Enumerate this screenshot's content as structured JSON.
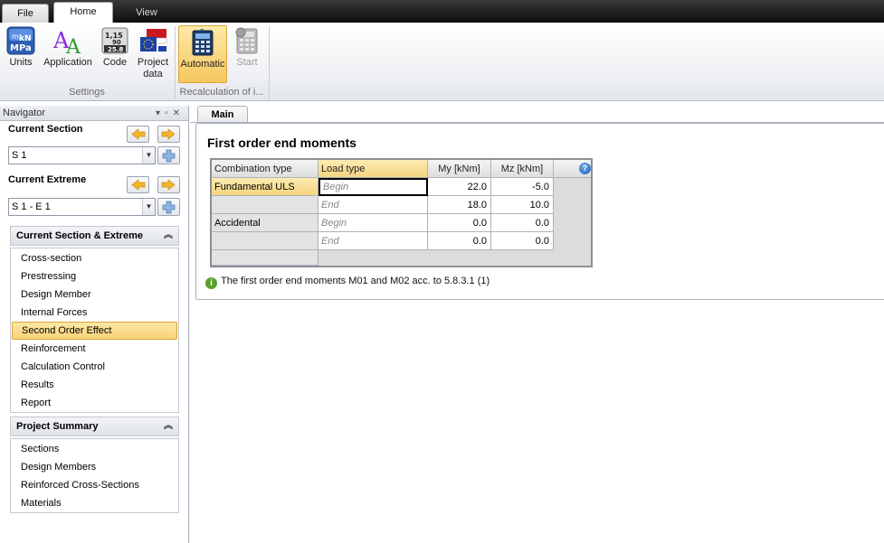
{
  "tabs": {
    "file": "File",
    "home": "Home",
    "view": "View"
  },
  "ribbon": {
    "settings": {
      "group_label": "Settings",
      "units": "Units",
      "application": "Application",
      "code": "Code",
      "project_data_line1": "Project",
      "project_data_line2": "data"
    },
    "recalc": {
      "group_label": "Recalculation of i...",
      "automatic": "Automatic",
      "start": "Start"
    }
  },
  "navigator": {
    "title": "Navigator",
    "current_section_label": "Current Section",
    "current_section_value": "S 1",
    "current_extreme_label": "Current Extreme",
    "current_extreme_value": "S 1 - E 1",
    "cse_header": "Current Section & Extreme",
    "cse_items": [
      "Cross-section",
      "Prestressing",
      "Design Member",
      "Internal Forces",
      "Second Order Effect",
      "Reinforcement",
      "Calculation Control",
      "Results",
      "Report"
    ],
    "selected_item": "Second Order Effect",
    "ps_header": "Project Summary",
    "ps_items": [
      "Sections",
      "Design Members",
      "Reinforced Cross-Sections",
      "Materials"
    ]
  },
  "main": {
    "tab": "Main",
    "title": "First order end moments",
    "table": {
      "headers": [
        "Combination type",
        "Load type",
        "My [kNm]",
        "Mz [kNm]"
      ],
      "rows": [
        {
          "combo": "Fundamental ULS",
          "load": "Begin",
          "my": "22.0",
          "mz": "-5.0"
        },
        {
          "combo": "",
          "load": "End",
          "my": "18.0",
          "mz": "10.0"
        },
        {
          "combo": "Accidental",
          "load": "Begin",
          "my": "0.0",
          "mz": "0.0"
        },
        {
          "combo": "",
          "load": "End",
          "my": "0.0",
          "mz": "0.0"
        }
      ]
    },
    "note": "The first order end moments M01 and M02 acc. to 5.8.3.1 (1)"
  }
}
